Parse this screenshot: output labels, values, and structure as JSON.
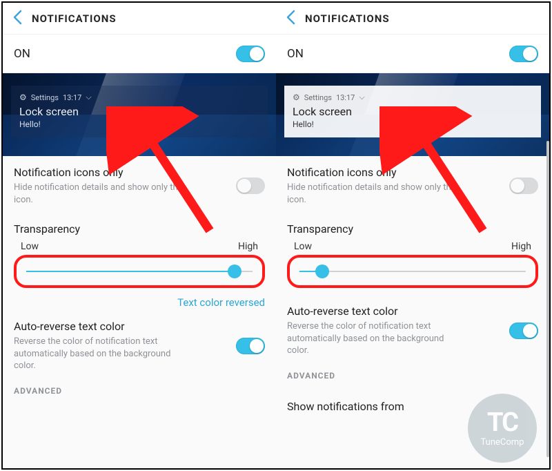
{
  "header": {
    "title": "NOTIFICATIONS"
  },
  "on_row": {
    "label": "ON"
  },
  "preview": {
    "app": "Settings",
    "time": "13:17",
    "title": "Lock screen",
    "body": "Hello!"
  },
  "icons_only": {
    "title": "Notification icons only",
    "sub": "Hide notification details and show only the icon."
  },
  "transparency": {
    "title": "Transparency",
    "low": "Low",
    "high": "High",
    "reversed_label": "Text color reversed"
  },
  "auto_reverse": {
    "title": "Auto-reverse text color",
    "sub": "Reverse the color of notification text automatically based on the background color."
  },
  "advanced": "ADVANCED",
  "show_from": "Show notifications from",
  "watermark": {
    "abbr": "TC",
    "name": "TuneComp"
  },
  "chart_data": {
    "type": "slider",
    "left": {
      "value_percent": 92,
      "range_labels": [
        "Low",
        "High"
      ]
    },
    "right": {
      "value_percent": 10,
      "range_labels": [
        "Low",
        "High"
      ]
    }
  }
}
